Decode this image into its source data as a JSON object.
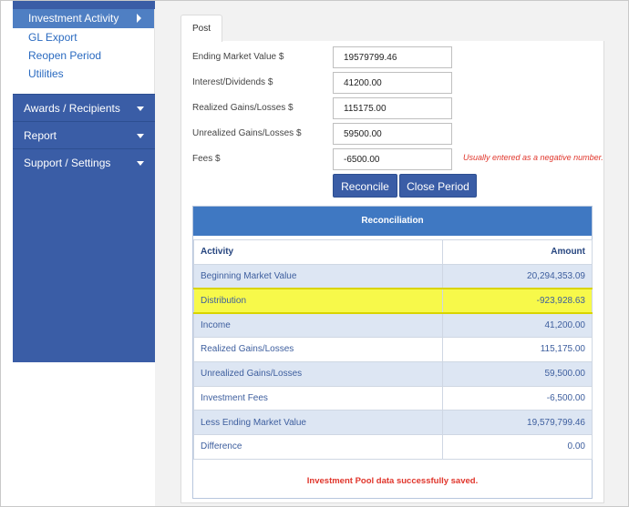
{
  "sidebar": {
    "active_item": "Investment Activity",
    "sub_items": [
      "GL Export",
      "Reopen Period",
      "Utilities"
    ],
    "nav_items": [
      "Awards / Recipients",
      "Report",
      "Support / Settings"
    ]
  },
  "tab": {
    "label": "Post"
  },
  "form": {
    "fields": [
      {
        "label": "Ending Market Value $",
        "value": "19579799.46"
      },
      {
        "label": "Interest/Dividends $",
        "value": "41200.00"
      },
      {
        "label": "Realized Gains/Losses $",
        "value": "115175.00"
      },
      {
        "label": "Unrealized Gains/Losses $",
        "value": "59500.00"
      },
      {
        "label": "Fees $",
        "value": "-6500.00"
      }
    ],
    "fees_hint": "Usually entered as a negative number.",
    "reconcile_label": "Reconcile",
    "close_period_label": "Close Period"
  },
  "reconciliation": {
    "title": "Reconciliation",
    "col_activity": "Activity",
    "col_amount": "Amount",
    "rows": [
      {
        "activity": "Beginning Market Value",
        "amount": "20,294,353.09"
      },
      {
        "activity": "Distribution",
        "amount": "-923,928.63"
      },
      {
        "activity": "Income",
        "amount": "41,200.00"
      },
      {
        "activity": "Realized Gains/Losses",
        "amount": "115,175.00"
      },
      {
        "activity": "Unrealized Gains/Losses",
        "amount": "59,500.00"
      },
      {
        "activity": "Investment Fees",
        "amount": "-6,500.00"
      },
      {
        "activity": "Less Ending Market Value",
        "amount": "19,579,799.46"
      },
      {
        "activity": "Difference",
        "amount": "0.00"
      }
    ],
    "status_message": "Investment Pool data successfully saved."
  },
  "colors": {
    "sidebar_bg": "#3a5da6",
    "header_blue": "#3f78c2",
    "highlight": "#f7f94a",
    "error_red": "#e0352b"
  }
}
